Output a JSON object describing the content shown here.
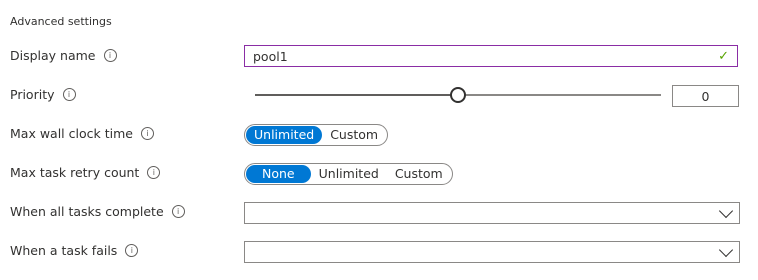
{
  "section_title": "Advanced settings",
  "display_name": {
    "label": "Display name",
    "value": "pool1",
    "valid_icon": "check-icon"
  },
  "priority": {
    "label": "Priority",
    "slider_value_fraction": 0.5,
    "value": "0"
  },
  "max_wall_clock": {
    "label": "Max wall clock time",
    "options": [
      "Unlimited",
      "Custom"
    ],
    "selected": "Unlimited"
  },
  "max_task_retry": {
    "label": "Max task retry count",
    "options": [
      "None",
      "Unlimited",
      "Custom"
    ],
    "selected": "None"
  },
  "when_all_tasks_complete": {
    "label": "When all tasks complete",
    "value": ""
  },
  "when_task_fails": {
    "label": "When a task fails",
    "value": ""
  },
  "icons": {
    "info": "info-icon",
    "dropdown": "chevron-down-icon"
  },
  "colors": {
    "accent": "#0078d4",
    "focus_border": "#8a2da5",
    "valid": "#57a300"
  }
}
